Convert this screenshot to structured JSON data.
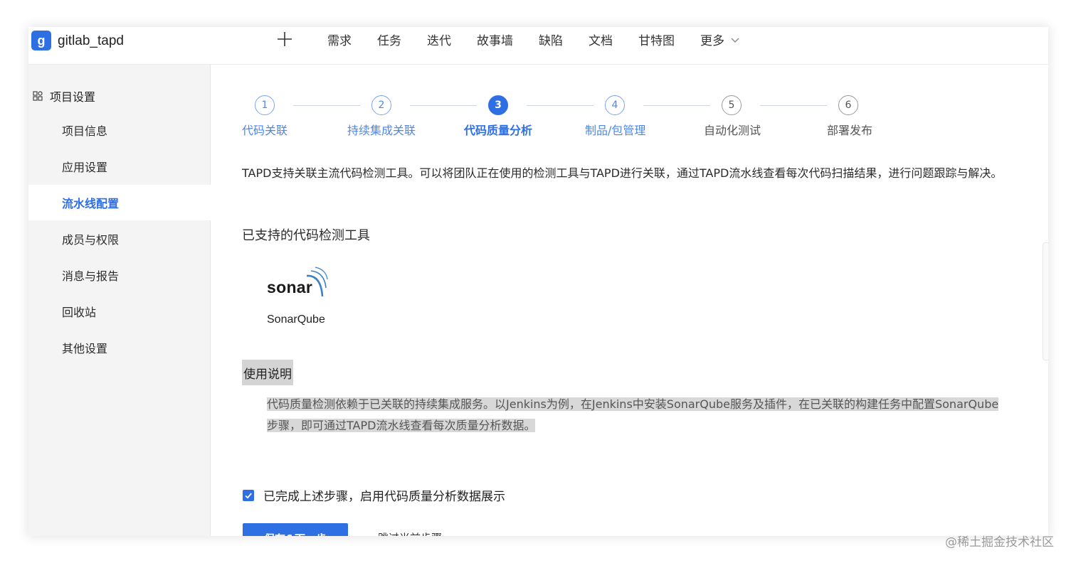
{
  "header": {
    "logo_letter": "g",
    "project_name": "gitlab_tapd",
    "nav": [
      "需求",
      "任务",
      "迭代",
      "故事墙",
      "缺陷",
      "文档",
      "甘特图"
    ],
    "more_label": "更多"
  },
  "sidebar": {
    "heading": "项目设置",
    "items": [
      {
        "label": "项目信息"
      },
      {
        "label": "应用设置"
      },
      {
        "label": "流水线配置",
        "active": true
      },
      {
        "label": "成员与权限"
      },
      {
        "label": "消息与报告"
      },
      {
        "label": "回收站"
      },
      {
        "label": "其他设置"
      }
    ]
  },
  "steps": [
    {
      "num": "1",
      "label": "代码关联",
      "state": "done"
    },
    {
      "num": "2",
      "label": "持续集成关联",
      "state": "done"
    },
    {
      "num": "3",
      "label": "代码质量分析",
      "state": "active"
    },
    {
      "num": "4",
      "label": "制品/包管理",
      "state": "done"
    },
    {
      "num": "5",
      "label": "自动化测试",
      "state": "pending"
    },
    {
      "num": "6",
      "label": "部署发布",
      "state": "pending"
    }
  ],
  "main": {
    "description": "TAPD支持关联主流代码检测工具。可以将团队正在使用的检测工具与TAPD进行关联，通过TAPD流水线查看每次代码扫描结果，进行问题跟踪与解决。",
    "tools_title": "已支持的代码检测工具",
    "tool_logo_text": "sonar",
    "tool_name": "SonarQube",
    "usage_title": "使用说明",
    "usage_text": "代码质量检测依赖于已关联的持续集成服务。以Jenkins为例，在Jenkins中安装SonarQube服务及插件，在已关联的构建任务中配置SonarQube步骤，即可通过TAPD流水线查看每次质量分析数据。",
    "confirm_label": "已完成上述步骤，启用代码质量分析数据展示",
    "confirm_checked": true,
    "save_label": "保存&下一步",
    "skip_label": "跳过当前步骤"
  },
  "watermark": "@稀土掘金技术社区",
  "colors": {
    "accent": "#2f6fe4",
    "step_done": "#4f86e8",
    "sidebar_bg": "#f4f4f5"
  }
}
